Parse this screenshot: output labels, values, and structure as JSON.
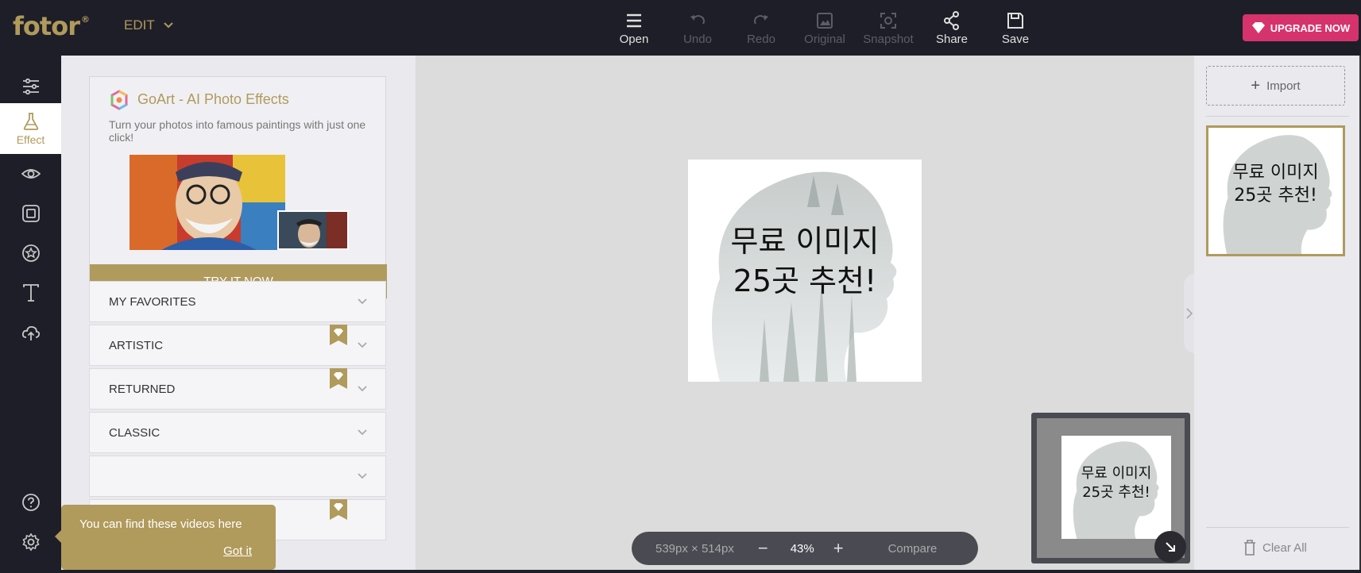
{
  "app": {
    "logo": "fotor",
    "logo_mark": "®",
    "edit_menu": "EDIT",
    "upgrade_label": "UPGRADE NOW",
    "colors": {
      "accent": "#b09a5c",
      "upgrade": "#d6336c",
      "dark": "#1e1e28"
    }
  },
  "toolbar": [
    {
      "label": "Open",
      "icon": "menu-icon",
      "enabled": true
    },
    {
      "label": "Undo",
      "icon": "undo-icon",
      "enabled": false
    },
    {
      "label": "Redo",
      "icon": "redo-icon",
      "enabled": false
    },
    {
      "label": "Original",
      "icon": "image-icon",
      "enabled": false
    },
    {
      "label": "Snapshot",
      "icon": "camera-icon",
      "enabled": false
    },
    {
      "label": "Share",
      "icon": "share-icon",
      "enabled": true
    },
    {
      "label": "Save",
      "icon": "save-icon",
      "enabled": true
    }
  ],
  "sidebar": {
    "active_label": "Effect",
    "items": [
      "adjust-icon",
      "effect-flask-icon",
      "eye-icon",
      "frame-icon",
      "sticker-icon",
      "text-icon",
      "cloud-upload-icon"
    ],
    "bottom": [
      "help-icon",
      "settings-icon"
    ]
  },
  "promo": {
    "title": "GoArt - AI Photo Effects",
    "description": "Turn your photos into famous paintings with just one click!",
    "button": "TRY IT NOW"
  },
  "categories": [
    {
      "label": "MY FAVORITES",
      "pro": false
    },
    {
      "label": "ARTISTIC",
      "pro": true
    },
    {
      "label": "RETURNED",
      "pro": true
    },
    {
      "label": "CLASSIC",
      "pro": false
    }
  ],
  "tooltip": {
    "message": "You can find these videos here",
    "action": "Got it"
  },
  "canvas": {
    "image_text_line1": "무료 이미지",
    "image_text_line2": "25곳 추천!",
    "dimensions": "539px × 514px",
    "zoom": "43%",
    "zoom_out": "−",
    "zoom_in": "+",
    "compare": "Compare"
  },
  "right_panel": {
    "import_label": "Import",
    "import_plus": "+",
    "clear_all": "Clear All"
  }
}
